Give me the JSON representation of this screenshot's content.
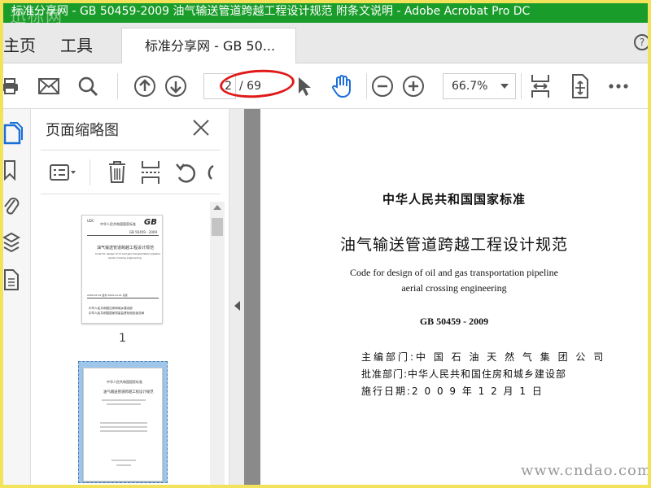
{
  "window": {
    "title": "标准分享网 - GB 50459-2009 油气输送管道跨越工程设计规范 附条文说明 - Adobe Acrobat Pro DC",
    "watermark_top": "迅标网"
  },
  "tabs": {
    "home": "主页",
    "tools": "工具",
    "document": "标准分享网 - GB 50...",
    "help": "?"
  },
  "toolbar": {
    "page_current": "2",
    "page_total": "/ 69",
    "zoom": "66.7%"
  },
  "panel": {
    "title": "页面缩略图",
    "thumbnails": [
      {
        "label": "1",
        "title_cn": "油气输送管道跨越工程设计规范",
        "title_en_1": "Code for design of oil and gas transportation pipeline",
        "title_en_2": "aerial crossing engineering",
        "top_left": "UDC",
        "top_center": "中华人民共和国国家标准",
        "logo": "GB",
        "code": "GB 50459 - 2009",
        "dates": "2009-03-31 发布          2009-12-01 实施",
        "publisher_1": "中华人民共和国住房和城乡建设部",
        "publisher_2": "中华人民共和国国家质量监督检验检疫总局"
      },
      {
        "header": "中华人民共和国国家标准",
        "title_cn": "油气输送管道跨越工程设计规范"
      }
    ]
  },
  "document": {
    "heading": "中华人民共和国国家标准",
    "title_cn": "油气输送管道跨越工程设计规范",
    "title_en_1": "Code for design of oil and gas transportation pipeline",
    "title_en_2": "aerial crossing engineering",
    "code": "GB 50459 - 2009",
    "info": [
      {
        "label": "主编部门:",
        "value": "中 国 石 油 天 然 气 集 团 公 司"
      },
      {
        "label": "批准部门:",
        "value": "中华人民共和国住房和城乡建设部"
      },
      {
        "label": "施行日期:",
        "value": "2 0 0 9  年  1 2  月  1  日"
      }
    ]
  },
  "watermark_bottom": "www.cndao.com",
  "colors": {
    "titlebar": "#1a9c2a",
    "frame": "#f2e35a",
    "annotation": "#e01a1a",
    "accent_blue": "#1a6fd6"
  }
}
